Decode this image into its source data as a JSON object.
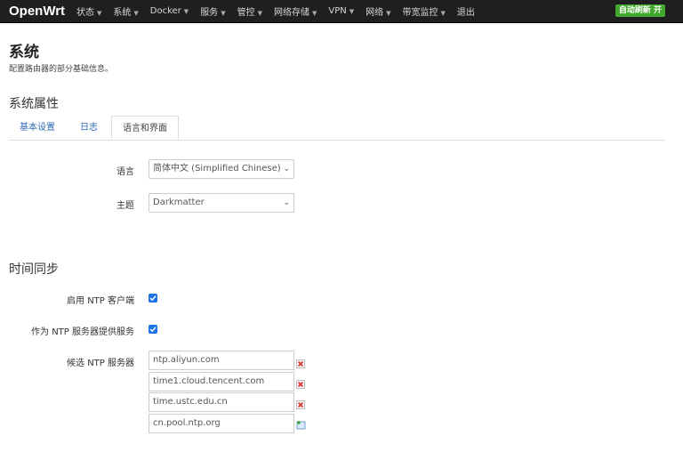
{
  "nav": {
    "brand": "OpenWrt",
    "items": [
      {
        "label": "状态",
        "caret": "▼"
      },
      {
        "label": "系统",
        "caret": "▼"
      },
      {
        "label": "Docker",
        "caret": "▼"
      },
      {
        "label": "服务",
        "caret": "▼"
      },
      {
        "label": "管控",
        "caret": "▼"
      },
      {
        "label": "网络存储",
        "caret": "▼"
      },
      {
        "label": "VPN",
        "caret": "▼"
      },
      {
        "label": "网络",
        "caret": "▼"
      },
      {
        "label": "带宽监控",
        "caret": "▼"
      },
      {
        "label": "退出",
        "caret": ""
      }
    ],
    "refresh_badge": "自动刷新 开"
  },
  "page": {
    "title": "系统",
    "description": "配置路由器的部分基础信息。"
  },
  "system_properties": {
    "title": "系统属性",
    "tabs": [
      {
        "label": "基本设置",
        "active": false
      },
      {
        "label": "日志",
        "active": false
      },
      {
        "label": "语言和界面",
        "active": true
      }
    ],
    "language": {
      "label": "语言",
      "value": "简体中文 (Simplified Chinese)"
    },
    "theme": {
      "label": "主题",
      "value": "Darkmatter"
    }
  },
  "time_sync": {
    "title": "时间同步",
    "enable_ntp_client": {
      "label": "启用 NTP 客户端",
      "checked": true
    },
    "ntp_server": {
      "label": "作为 NTP 服务器提供服务",
      "checked": true
    },
    "candidate_servers": {
      "label": "候选 NTP 服务器",
      "values": [
        "ntp.aliyun.com",
        "time1.cloud.tencent.com",
        "time.ustc.edu.cn",
        "cn.pool.ntp.org"
      ]
    }
  },
  "colors": {
    "navbar": "#1f1f1f",
    "accent": "#1a73e8",
    "tab_link": "#2d6ab3",
    "refresh_badge": "#42a72e",
    "remove_icon": "#d9322b",
    "add_icon": "#3aa63a"
  }
}
